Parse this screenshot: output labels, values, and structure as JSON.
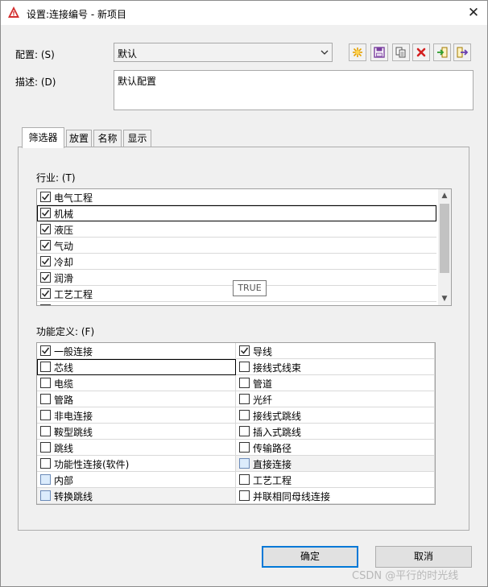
{
  "window": {
    "title": "设置:连接编号 - 新项目"
  },
  "config": {
    "label": "配置: (S)",
    "value": "默认"
  },
  "toolbar": {
    "icons": [
      "new-icon",
      "save-icon",
      "copy-icon",
      "delete-icon",
      "import-icon",
      "export-icon"
    ]
  },
  "description": {
    "label": "描述: (D)",
    "value": "默认配置"
  },
  "tabs": [
    {
      "label": "筛选器",
      "active": true
    },
    {
      "label": "放置",
      "active": false
    },
    {
      "label": "名称",
      "active": false
    },
    {
      "label": "显示",
      "active": false
    }
  ],
  "industry": {
    "label": "行业: (T)",
    "items": [
      {
        "label": "电气工程",
        "checked": true
      },
      {
        "label": "机械",
        "checked": true
      },
      {
        "label": "液压",
        "checked": true
      },
      {
        "label": "气动",
        "checked": true
      },
      {
        "label": "冷却",
        "checked": true
      },
      {
        "label": "润滑",
        "checked": true
      },
      {
        "label": "工艺工程",
        "checked": true
      },
      {
        "label": "",
        "checked": true
      }
    ]
  },
  "tooltip": "TRUE",
  "function": {
    "label": "功能定义: (F)",
    "items": [
      {
        "label": "一般连接",
        "checked": true,
        "blue": false,
        "shaded": false
      },
      {
        "label": "导线",
        "checked": true,
        "blue": false,
        "shaded": false
      },
      {
        "label": "芯线",
        "checked": false,
        "blue": false,
        "shaded": false
      },
      {
        "label": "接线式线束",
        "checked": false,
        "blue": false,
        "shaded": false
      },
      {
        "label": "电缆",
        "checked": false,
        "blue": false,
        "shaded": false
      },
      {
        "label": "管道",
        "checked": false,
        "blue": false,
        "shaded": false
      },
      {
        "label": "管路",
        "checked": false,
        "blue": false,
        "shaded": false
      },
      {
        "label": "光纤",
        "checked": false,
        "blue": false,
        "shaded": false
      },
      {
        "label": "非电连接",
        "checked": false,
        "blue": false,
        "shaded": false
      },
      {
        "label": "接线式跳线",
        "checked": false,
        "blue": false,
        "shaded": false
      },
      {
        "label": "鞍型跳线",
        "checked": false,
        "blue": false,
        "shaded": false
      },
      {
        "label": "插入式跳线",
        "checked": false,
        "blue": false,
        "shaded": false
      },
      {
        "label": "跳线",
        "checked": false,
        "blue": false,
        "shaded": false
      },
      {
        "label": "传输路径",
        "checked": false,
        "blue": false,
        "shaded": false
      },
      {
        "label": "功能性连接(软件)",
        "checked": false,
        "blue": false,
        "shaded": false
      },
      {
        "label": "直接连接",
        "checked": false,
        "blue": true,
        "shaded": true
      },
      {
        "label": "内部",
        "checked": false,
        "blue": true,
        "shaded": false
      },
      {
        "label": "工艺工程",
        "checked": false,
        "blue": false,
        "shaded": false
      },
      {
        "label": "转换跳线",
        "checked": false,
        "blue": true,
        "shaded": true
      },
      {
        "label": "并联相同母线连接",
        "checked": false,
        "blue": false,
        "shaded": false
      }
    ]
  },
  "buttons": {
    "ok": "确定",
    "cancel": "取消"
  },
  "watermark": "CSDN @平行的时光线",
  "colors": {
    "accent": "#0078d7",
    "app_icon": "#d32f2f"
  }
}
